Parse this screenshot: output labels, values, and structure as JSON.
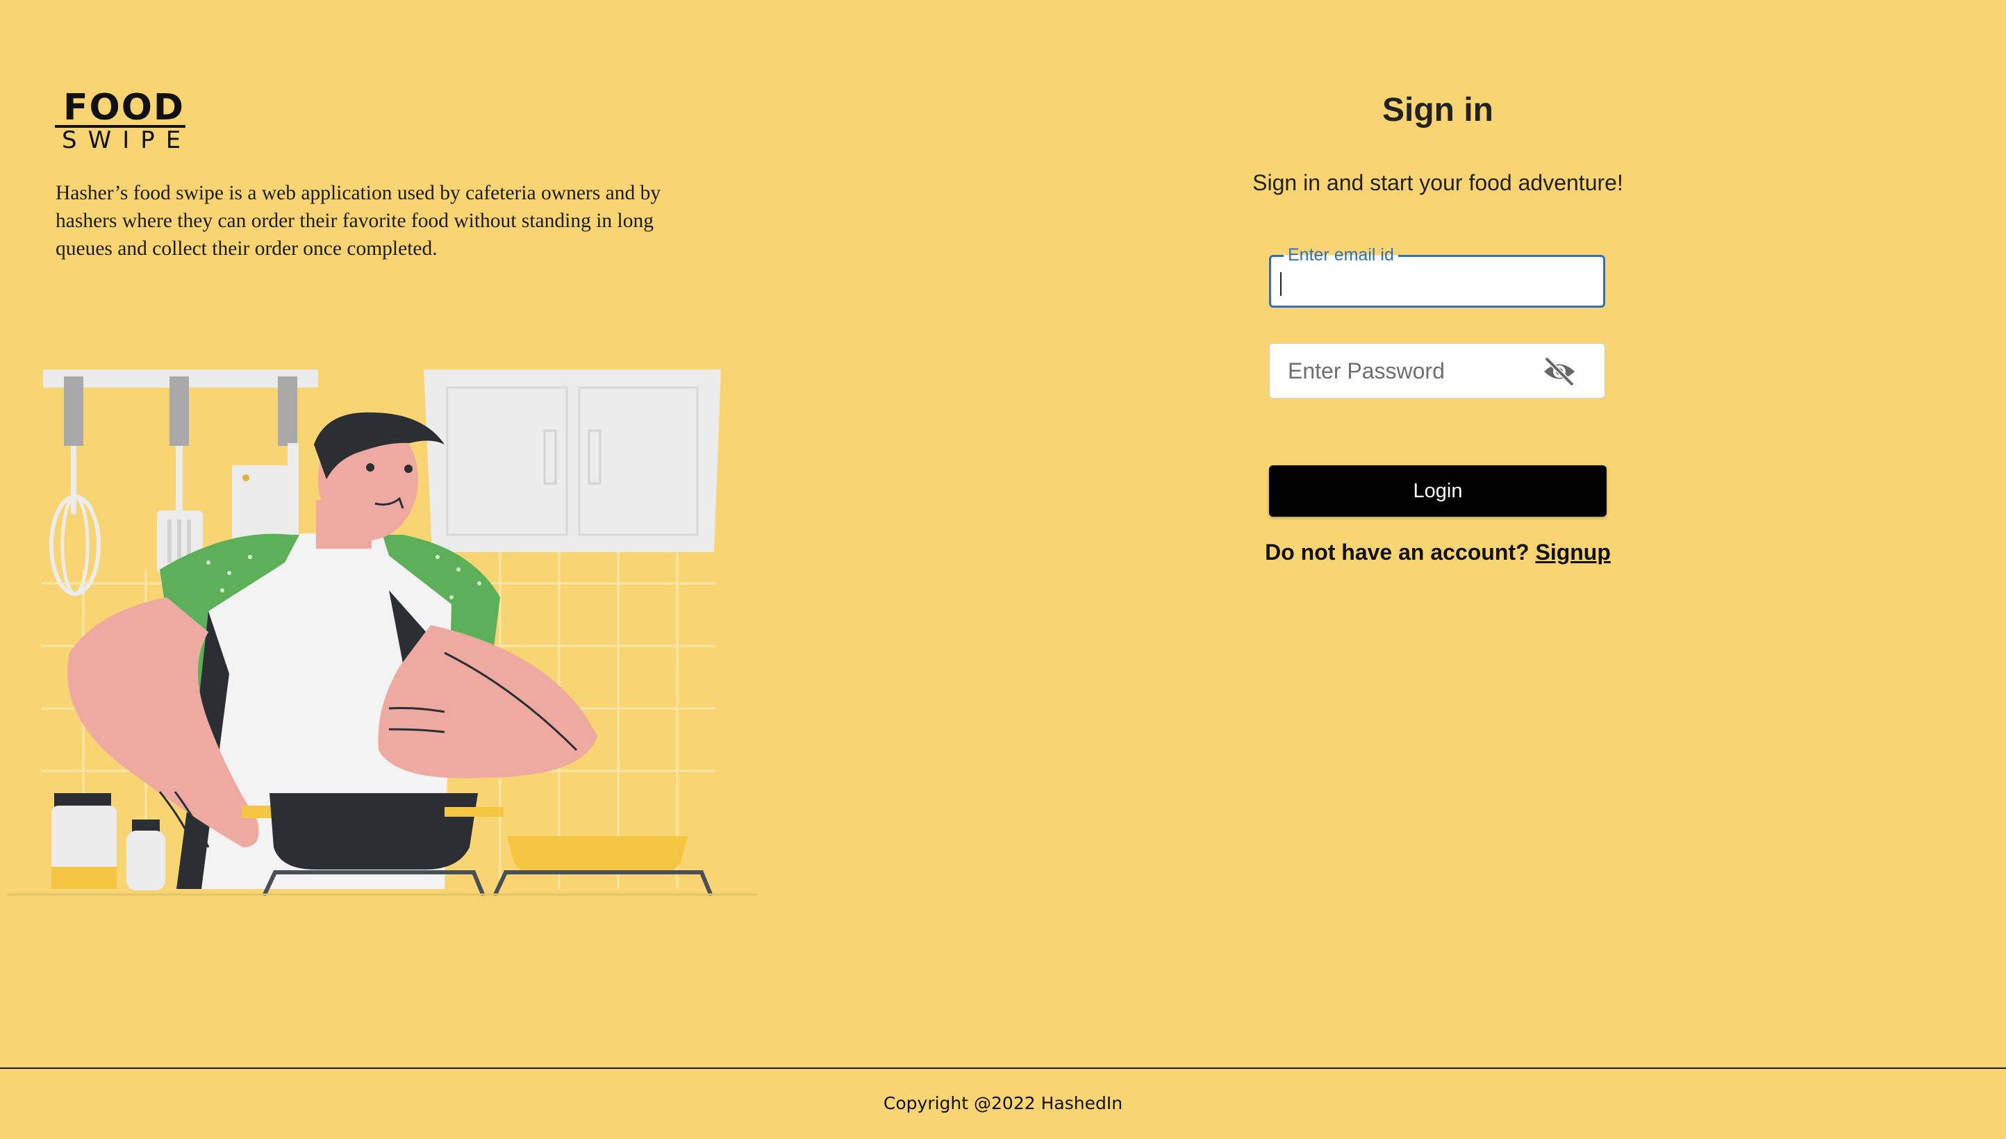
{
  "brand": {
    "logo_top": "FOOD",
    "logo_bottom": "SWIPE"
  },
  "intro": {
    "text": "Hasher’s food swipe is a web application used by cafeteria owners and by hashers where they can order their favorite food without standing in long queues and collect their order once completed."
  },
  "signin": {
    "title": "Sign in",
    "subtitle": "Sign in and start your food adventure!",
    "email": {
      "label": "Enter email id",
      "value": ""
    },
    "password": {
      "placeholder": "Enter Password",
      "visibility_icon": "eye-off-icon"
    },
    "login_label": "Login",
    "signup_prompt": "Do not have an account?",
    "signup_link": "Signup"
  },
  "footer": {
    "copyright": "Copyright @2022 HashedIn"
  },
  "colors": {
    "background": "#f8d572",
    "focus_blue": "#2f6fbd",
    "button": "#000000",
    "shirt_green": "#5db05a",
    "skin": "#eeaaa0"
  }
}
